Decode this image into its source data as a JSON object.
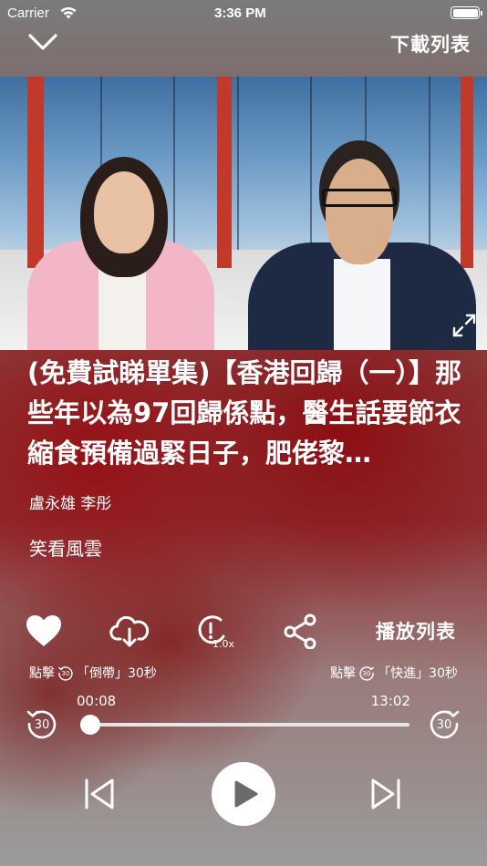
{
  "status_bar": {
    "carrier": "Carrier",
    "time": "3:36 PM"
  },
  "header": {
    "download_list_label": "下載列表"
  },
  "episode": {
    "title": "(免費試睇單集)【香港回歸（一）】那些年以為97回歸係點，醫生話要節衣縮食預備過緊日子，肥佬黎…",
    "hosts": "盧永雄 李彤",
    "program": "笑看風雲"
  },
  "controls": {
    "playlist_label": "播放列表",
    "speed": "1.0x",
    "rewind_hint_prefix": "點擊",
    "rewind_hint_suffix": "「倒帶」30秒",
    "forward_hint_prefix": "點擊",
    "forward_hint_suffix": "「快進」30秒",
    "skip_seconds": "30"
  },
  "progress": {
    "current_time": "00:08",
    "total_time": "13:02",
    "fraction": 0.01
  },
  "colors": {
    "accent": "#ffffff",
    "video_pillar": "#c0392b"
  },
  "icons": [
    "collapse-chevron-icon",
    "wifi-icon",
    "battery-icon",
    "expand-icon",
    "heart-icon",
    "cloud-download-icon",
    "speed-icon",
    "share-icon",
    "rewind-30-icon",
    "forward-30-icon",
    "previous-track-icon",
    "play-icon",
    "next-track-icon"
  ]
}
